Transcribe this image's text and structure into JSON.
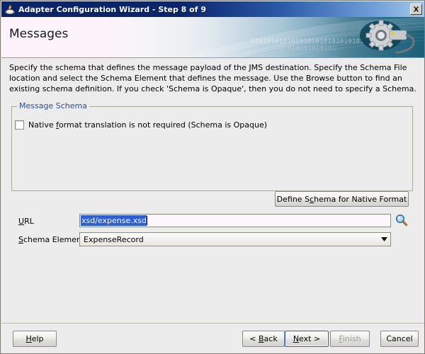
{
  "window": {
    "title": "Adapter Configuration Wizard - Step 8 of 9",
    "icon": "wizard-icon",
    "close_label": "Close"
  },
  "banner": {
    "title": "Messages",
    "binary_primary": "0101010101010101010101010101",
    "binary_secondary": "010101010101",
    "gear_icon": "gear-cable-icon"
  },
  "description": "Specify the schema that defines the message payload of the JMS destination.  Specify the Schema File location and select the Schema Element that defines the message. Use the Browse button to find an existing schema definition. If you check 'Schema is Opaque', then you do not need to specify a Schema.",
  "message_schema": {
    "group_title": "Message Schema",
    "opaque_checkbox": {
      "label_before": "Native ",
      "mnemonic": "f",
      "label_after": "ormat translation is not required (Schema is Opaque)",
      "checked": false
    },
    "define_button": {
      "label_before": "Define S",
      "mnemonic": "c",
      "label_after": "hema for Native Format"
    },
    "url": {
      "label_mnemonic": "U",
      "label_rest": "RL",
      "value": "xsd/expense.xsd",
      "selected": true,
      "browse_icon": "magnifier-icon"
    },
    "schema_element": {
      "label_mnemonic": "S",
      "label_rest": "chema Element",
      "value": "ExpenseRecord",
      "options": [
        "ExpenseRecord"
      ]
    }
  },
  "footer": {
    "help": {
      "mnemonic": "H",
      "rest": "elp"
    },
    "back": {
      "before": "< ",
      "mnemonic": "B",
      "rest": "ack"
    },
    "next": {
      "mnemonic": "N",
      "rest": "ext >"
    },
    "finish": {
      "mnemonic": "F",
      "rest": "inish",
      "disabled": true
    },
    "cancel": {
      "label": "Cancel",
      "disabled": false
    }
  },
  "colors": {
    "titlebar_start": "#0a246a",
    "titlebar_end": "#a6c8ea",
    "group_title": "#2b4f8c",
    "selection": "#2b5fd9",
    "focus_ring": "#2a5ab4",
    "dialog_bg": "#ececec"
  }
}
